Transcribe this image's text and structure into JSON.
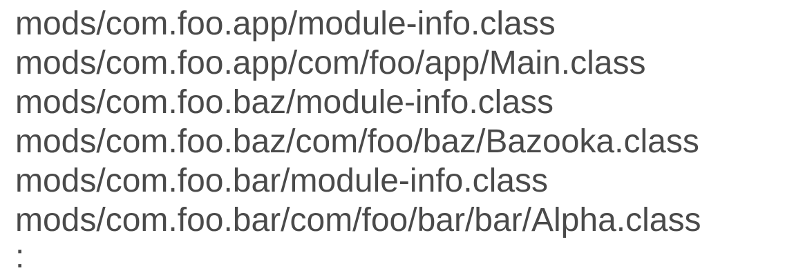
{
  "files": [
    "mods/com.foo.app/module-info.class",
    "mods/com.foo.app/com/foo/app/Main.class",
    "mods/com.foo.baz/module-info.class",
    "mods/com.foo.baz/com/foo/baz/Bazooka.class",
    "mods/com.foo.bar/module-info.class",
    "mods/com.foo.bar/com/foo/bar/bar/Alpha.class"
  ],
  "continuation": ":"
}
